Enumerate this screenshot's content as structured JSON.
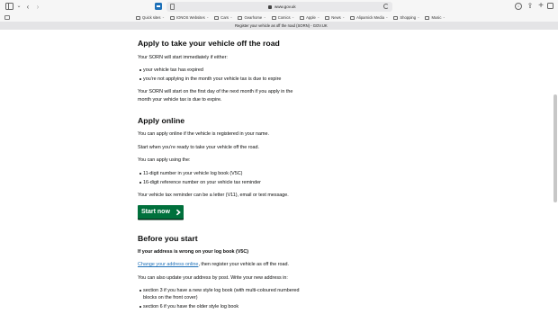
{
  "browser": {
    "url": "www.gov.uk",
    "tab_title": "Register your vehicle as off the road (SORN) - GOV.UK",
    "bookmarks": [
      {
        "label": "Quick sites",
        "has_menu": true
      },
      {
        "label": "IONOS Websites",
        "has_menu": true
      },
      {
        "label": "Cars",
        "has_menu": true
      },
      {
        "label": "Gearhome",
        "has_menu": true
      },
      {
        "label": "Comics",
        "has_menu": true
      },
      {
        "label": "Apple",
        "has_menu": true
      },
      {
        "label": "News",
        "has_menu": true
      },
      {
        "label": "Aliparnick Media",
        "has_menu": true
      },
      {
        "label": "Shopping",
        "has_menu": true
      },
      {
        "label": "Music",
        "has_menu": true
      }
    ],
    "icons": {
      "sidebar": "sidebar-icon",
      "back": "chevron-left-icon",
      "forward": "chevron-right-icon",
      "download": "download-icon",
      "share": "share-icon",
      "new_tab": "plus-icon",
      "tabs_overview": "tabs-overview-icon"
    }
  },
  "page": {
    "section1": {
      "heading": "Apply to take your vehicle off the road",
      "intro": "Your SORN will start immediately if either:",
      "bullets": [
        "your vehicle tax has expired",
        "you’re not applying in the month your vehicle tax is due to expire"
      ],
      "para_line1": "Your SORN will start on the first day of the next month if you apply in the",
      "para_line2": "month your vehicle tax is due to expire."
    },
    "section2": {
      "heading": "Apply online",
      "p1": "You can apply online if the vehicle is registered in your name.",
      "p2": "Start when you’re ready to take your vehicle off the road.",
      "p3": "You can apply using the:",
      "bullets": [
        "11-digit number in your vehicle log book (V5C)",
        "16-digit reference number on your vehicle tax reminder"
      ],
      "p4": "Your vehicle tax reminder can be a letter (V11), email or text message.",
      "start_button": "Start now"
    },
    "section3": {
      "heading": "Before you start",
      "subheading": "If your address is wrong on your log book (V5C)",
      "link_text": "Change your address online",
      "after_link": ", then register your vehicle as off the road.",
      "p2": "You can also update your address by post. Write your new address in:",
      "bullets": [
        "section 3 if you have a new style log book (with multi-coloured numbered",
        "blocks on the front cover)",
        "section 6 if you have the older style log book"
      ]
    }
  },
  "colors": {
    "start_button": "#00703c",
    "link": "#1d70b8",
    "text": "#0b0c0c"
  }
}
